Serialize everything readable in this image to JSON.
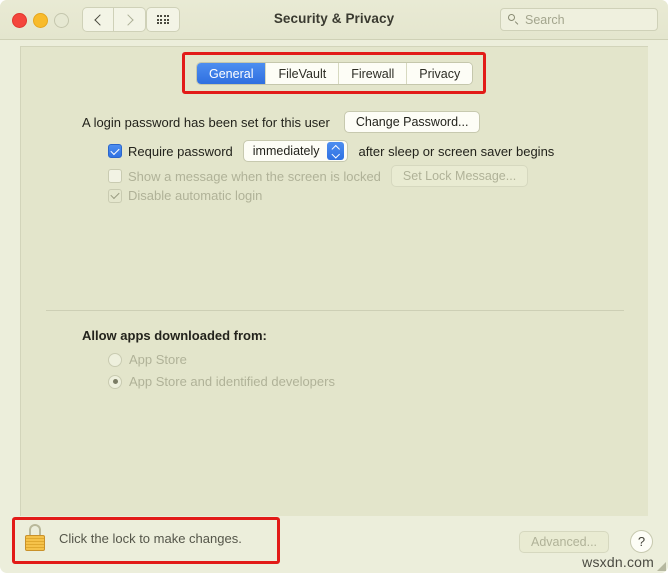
{
  "window": {
    "title": "Security & Privacy",
    "traffic_lights": [
      "close",
      "minimize",
      "zoom"
    ]
  },
  "toolbar": {
    "back_icon": "chevron-left-icon",
    "forward_icon": "chevron-right-icon",
    "grid_icon": "show-all-grid-icon",
    "search": {
      "icon": "search-icon",
      "placeholder": "Search",
      "value": ""
    }
  },
  "tabs": {
    "items": [
      {
        "label": "General",
        "active": true
      },
      {
        "label": "FileVault",
        "active": false
      },
      {
        "label": "Firewall",
        "active": false
      },
      {
        "label": "Privacy",
        "active": false
      }
    ]
  },
  "general": {
    "login_password_text": "A login password has been set for this user",
    "change_password_label": "Change Password...",
    "require_password": {
      "checked": true,
      "label": "Require password",
      "delay_value": "immediately",
      "suffix": "after sleep or screen saver begins"
    },
    "show_message": {
      "checked": false,
      "label": "Show a message when the screen is locked",
      "button_label": "Set Lock Message..."
    },
    "disable_auto_login": {
      "checked": true,
      "label": "Disable automatic login"
    }
  },
  "allow_apps": {
    "title": "Allow apps downloaded from:",
    "options": [
      {
        "label": "App Store",
        "selected": false
      },
      {
        "label": "App Store and identified developers",
        "selected": true
      }
    ]
  },
  "footer": {
    "lock_icon": "closed-padlock-icon",
    "lock_text": "Click the lock to make changes.",
    "advanced_label": "Advanced...",
    "help_label": "?"
  },
  "watermark": "wsxdn.com",
  "colors": {
    "accent_blue": "#2f72e2",
    "annotation_red": "#e21b18",
    "window_bg": "#eceedb",
    "panel_bg": "#e3e5cb",
    "lock_gold": "#f5c24a"
  }
}
